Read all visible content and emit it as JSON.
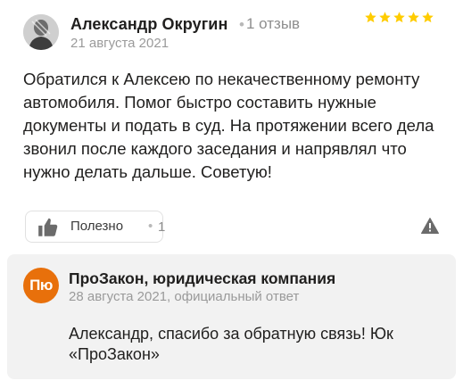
{
  "review": {
    "author_name": "Александр Округин",
    "separator": "•",
    "reviews_count": "1 отзыв",
    "date": "21 августа 2021",
    "rating": 5,
    "rating_max": 5,
    "text": "Обратился к Алексею по некачественному ремонту автомобиля. Помог быстро составить нужные документы и подать в суд. На протяжении всего дела звонил после каждого заседания и напрявлял что нужно делать дальше. Советую!",
    "helpful": {
      "label": "Полезно",
      "separator": "•",
      "count": "1"
    }
  },
  "answer": {
    "logo_text": "Пю",
    "company_name": "ПроЗакон, юридическая компания",
    "meta": "28 августа 2021, официальный ответ",
    "text": "Александр, спасибо за обратную связь! Юк «ПроЗакон»"
  },
  "colors": {
    "star": "#fc0",
    "logo": "#e8700b",
    "answer_bg": "#f2f2f2"
  }
}
